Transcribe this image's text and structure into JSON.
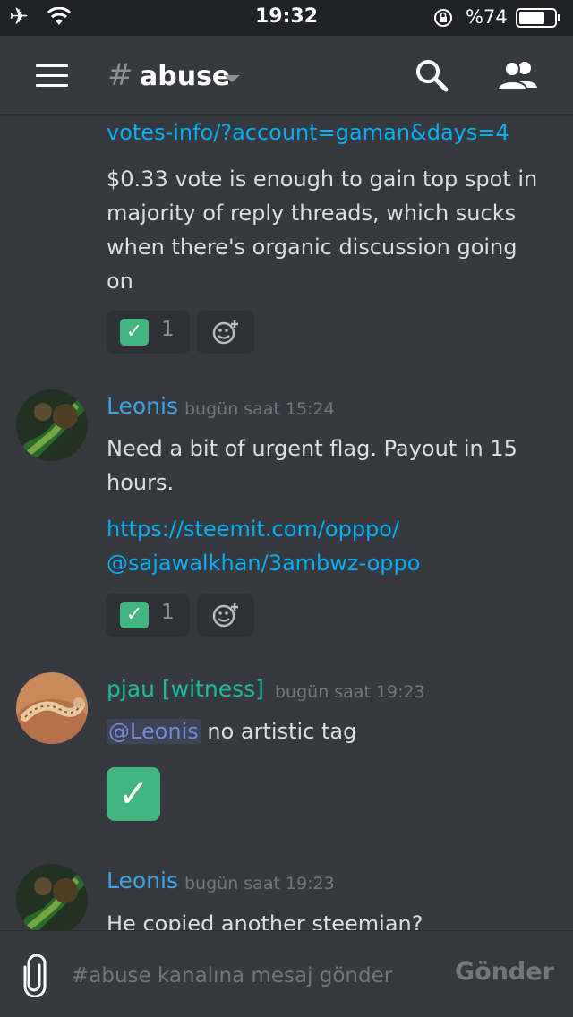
{
  "status_bar": {
    "time": "19:32",
    "battery": "%74",
    "battery_level": 0.74
  },
  "header": {
    "channel_hash": "#",
    "channel_name": "abuse"
  },
  "messages": {
    "partial": {
      "link_tail": "votes-info/?account=gaman&days=4",
      "text_lines": [
        "$0.33 vote is enough to gain top spot in",
        "majority of reply threads, which sucks",
        "when there's organic discussion going",
        "on"
      ],
      "reaction": {
        "emoji": "✓",
        "count": "1"
      }
    },
    "leonis_1": {
      "username": "Leonis",
      "username_color": "#3ca4e3",
      "timestamp": "bugün saat 15:24",
      "text_lines": [
        "Need a bit of urgent flag. Payout in 15",
        "hours."
      ],
      "link_lines": [
        "https://steemit.com/opppo/",
        "@sajawalkhan/3ambwz-oppo"
      ],
      "reaction": {
        "emoji": "✓",
        "count": "1"
      }
    },
    "pjau": {
      "username": "pjau [witness]",
      "username_color": "#1abc9c",
      "timestamp": "bugün saat 19:23",
      "mention": "@Leonis",
      "text": " no artistic tag",
      "big_emoji": "✓"
    },
    "leonis_2": {
      "username": "Leonis",
      "username_color": "#3ca4e3",
      "timestamp": "bugün saat 19:23",
      "text": "He copied another steemian?"
    }
  },
  "input": {
    "placeholder": "#abuse kanalına mesaj gönder",
    "send_label": "Gönder"
  },
  "colors": {
    "background": "#36393f",
    "status_bar": "#202225",
    "link": "#00b0f4",
    "reaction_green": "#43b581"
  },
  "icons": [
    "airplane-icon",
    "wifi-icon",
    "rotation-lock-icon",
    "battery-icon",
    "hamburger-icon",
    "search-icon",
    "members-icon",
    "add-reaction-icon",
    "paperclip-icon"
  ]
}
